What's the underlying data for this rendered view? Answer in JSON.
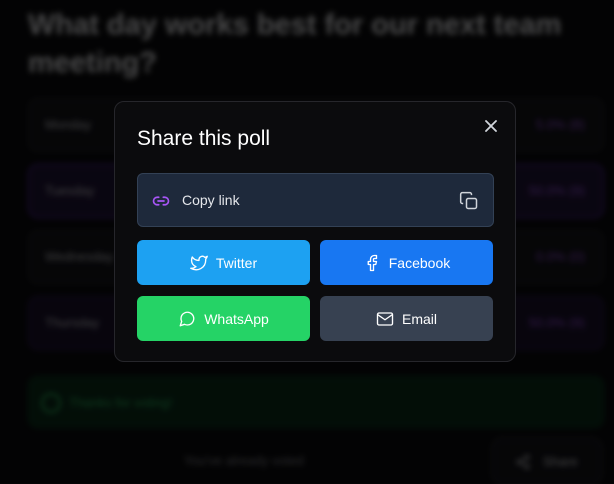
{
  "background": {
    "question": "What day works best for our next team meeting?",
    "options": [
      {
        "label": "Monday",
        "stat": "5.0% (8)"
      },
      {
        "label": "Tuesday",
        "stat": "50.0% (9)"
      },
      {
        "label": "Wednesday",
        "stat": "0.0% (0)"
      },
      {
        "label": "Thursday",
        "stat": "50.0% (9)"
      }
    ],
    "thanks": "Thanks for voting!",
    "voted": "You've already voted",
    "share_label": "Share"
  },
  "modal": {
    "title": "Share this poll",
    "copy_link_label": "Copy link",
    "buttons": {
      "twitter": "Twitter",
      "facebook": "Facebook",
      "whatsapp": "WhatsApp",
      "email": "Email"
    }
  },
  "colors": {
    "twitter": "#1da1f2",
    "facebook": "#1877f2",
    "whatsapp": "#25d366",
    "email": "#374151",
    "accent": "#a855f7"
  }
}
